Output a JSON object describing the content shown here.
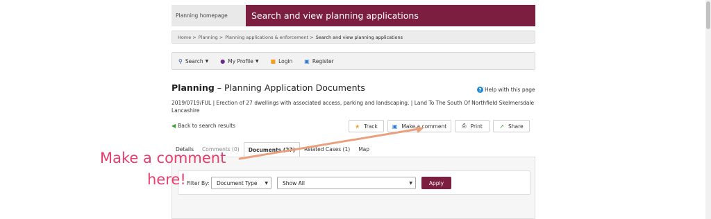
{
  "header": {
    "home_link": "Planning homepage",
    "site_title": "Search and view planning applications"
  },
  "breadcrumb": [
    "Home >",
    "Planning >",
    "Planning applications & enforcement >",
    "Search and view planning applications"
  ],
  "nav": {
    "search": "Search",
    "my_profile": "My Profile",
    "login": "Login",
    "register": "Register"
  },
  "page": {
    "title_bold": "Planning",
    "title_rest": " – Planning Application Documents",
    "help": "Help with this page",
    "description": "2019/0719/FUL | Erection of 27 dwellings with associated access, parking and landscaping. | Land To The South Of Northfield Skelmersdale Lancashire",
    "back": "Back to search results"
  },
  "actions": {
    "track": "Track",
    "comment": "Make a comment",
    "print": "Print",
    "share": "Share"
  },
  "tabs": {
    "details": "Details",
    "comments": "Comments (0)",
    "documents": "Documents (27)",
    "related": "Related Cases (1)",
    "map": "Map"
  },
  "filter": {
    "label": "Filter By:",
    "type_value": "Document Type",
    "show_value": "Show All",
    "apply": "Apply"
  },
  "annotation": {
    "line1": "Make a comment",
    "line2": "here!"
  },
  "colors": {
    "brand": "#7b1e3f",
    "annotation": "#e83d6d"
  }
}
